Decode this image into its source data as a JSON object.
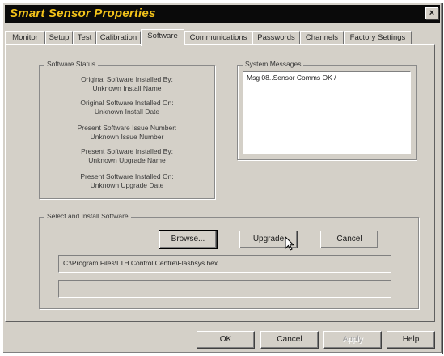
{
  "window": {
    "title": "Smart Sensor Properties",
    "close_label": "×"
  },
  "tabs": [
    {
      "label": "Monitor"
    },
    {
      "label": "Setup"
    },
    {
      "label": "Test"
    },
    {
      "label": "Calibration"
    },
    {
      "label": "Software",
      "active": true
    },
    {
      "label": "Communications"
    },
    {
      "label": "Passwords"
    },
    {
      "label": "Channels"
    },
    {
      "label": "Factory Settings"
    }
  ],
  "software_status": {
    "label": "Software Status",
    "lines": [
      "Original Software Installed By:",
      "Unknown Install Name",
      "Original Software Installed On:",
      "Unknown Install Date",
      "Present Software Issue Number:",
      "Unknown Issue Number",
      "Present Software Installed By:",
      "Unknown Upgrade Name",
      "Present Software Installed On:",
      "Unknown Upgrade Date"
    ]
  },
  "system_messages": {
    "label": "System Messages",
    "lines": [
      "Msg 08..Sensor Comms OK  /"
    ]
  },
  "select_install": {
    "label": "Select and Install Software",
    "browse_label": "Browse...",
    "upgrade_label": "Upgrade",
    "cancel_label": "Cancel",
    "path_value": "C:\\Program Files\\LTH Control Centre\\Flashsys.hex",
    "progress_value": ""
  },
  "footer": {
    "ok_label": "OK",
    "cancel_label": "Cancel",
    "apply_label": "Apply",
    "help_label": "Help"
  },
  "colors": {
    "title_text": "#f2c21a",
    "titlebar_bg": "#0a0a0a",
    "face": "#d4d0c8"
  },
  "icons": {
    "cursor": "mouse-pointer-icon",
    "close": "close-icon"
  }
}
